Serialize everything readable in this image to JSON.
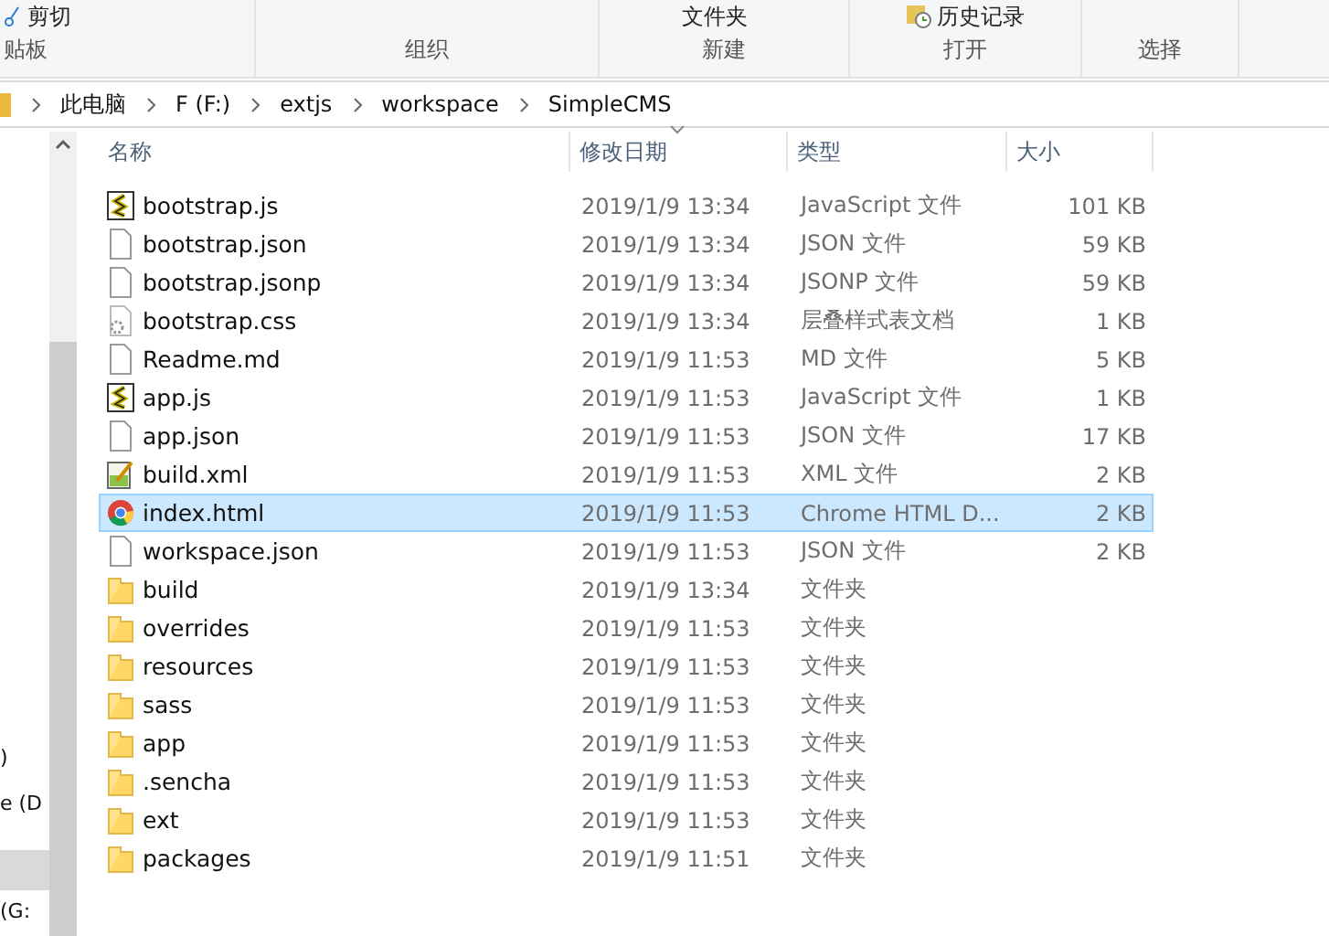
{
  "ribbon": {
    "top_items": [
      {
        "label": "剪切",
        "kind": "scissors"
      },
      {
        "label": "文件夹",
        "kind": "none"
      },
      {
        "label": "历史记录",
        "kind": "history"
      }
    ],
    "groups": [
      "贴板",
      "组织",
      "新建",
      "打开",
      "选择"
    ]
  },
  "breadcrumb": [
    "此电脑",
    "F (F:)",
    "extjs",
    "workspace",
    "SimpleCMS"
  ],
  "nav_pane": {
    "items": [
      {
        "label": ")",
        "selected": false
      },
      {
        "label": "e (D",
        "selected": false
      },
      {
        "selected": true
      },
      {
        "label": "(G:",
        "selected": false
      }
    ]
  },
  "table": {
    "columns": [
      "名称",
      "修改日期",
      "类型",
      "大小"
    ],
    "rows": [
      {
        "name": "bootstrap.js",
        "date": "2019/1/9 13:34",
        "type": "JavaScript 文件",
        "size": "101 KB",
        "kind": "script",
        "selected": false
      },
      {
        "name": "bootstrap.json",
        "date": "2019/1/9 13:34",
        "type": "JSON 文件",
        "size": "59 KB",
        "kind": "file",
        "selected": false
      },
      {
        "name": "bootstrap.jsonp",
        "date": "2019/1/9 13:34",
        "type": "JSONP 文件",
        "size": "59 KB",
        "kind": "file",
        "selected": false
      },
      {
        "name": "bootstrap.css",
        "date": "2019/1/9 13:34",
        "type": "层叠样式表文档",
        "size": "1 KB",
        "kind": "css",
        "selected": false
      },
      {
        "name": "Readme.md",
        "date": "2019/1/9 11:53",
        "type": "MD 文件",
        "size": "5 KB",
        "kind": "file",
        "selected": false
      },
      {
        "name": "app.js",
        "date": "2019/1/9 11:53",
        "type": "JavaScript 文件",
        "size": "1 KB",
        "kind": "script",
        "selected": false
      },
      {
        "name": "app.json",
        "date": "2019/1/9 11:53",
        "type": "JSON 文件",
        "size": "17 KB",
        "kind": "file",
        "selected": false
      },
      {
        "name": "build.xml",
        "date": "2019/1/9 11:53",
        "type": "XML 文件",
        "size": "2 KB",
        "kind": "xml",
        "selected": false
      },
      {
        "name": "index.html",
        "date": "2019/1/9 11:53",
        "type": "Chrome HTML D...",
        "size": "2 KB",
        "kind": "chrome",
        "selected": true
      },
      {
        "name": "workspace.json",
        "date": "2019/1/9 11:53",
        "type": "JSON 文件",
        "size": "2 KB",
        "kind": "file",
        "selected": false
      },
      {
        "name": "build",
        "date": "2019/1/9 13:34",
        "type": "文件夹",
        "kind": "folder",
        "selected": false
      },
      {
        "name": "overrides",
        "date": "2019/1/9 11:53",
        "type": "文件夹",
        "kind": "folder",
        "selected": false
      },
      {
        "name": "resources",
        "date": "2019/1/9 11:53",
        "type": "文件夹",
        "kind": "folder",
        "selected": false
      },
      {
        "name": "sass",
        "date": "2019/1/9 11:53",
        "type": "文件夹",
        "kind": "folder",
        "selected": false
      },
      {
        "name": "app",
        "date": "2019/1/9 11:53",
        "type": "文件夹",
        "kind": "folder",
        "selected": false
      },
      {
        "name": ".sencha",
        "date": "2019/1/9 11:53",
        "type": "文件夹",
        "kind": "folder",
        "selected": false
      },
      {
        "name": "ext",
        "date": "2019/1/9 11:53",
        "type": "文件夹",
        "kind": "folder",
        "selected": false
      },
      {
        "name": "packages",
        "date": "2019/1/9 11:51",
        "type": "文件夹",
        "kind": "folder",
        "selected": false
      }
    ]
  }
}
